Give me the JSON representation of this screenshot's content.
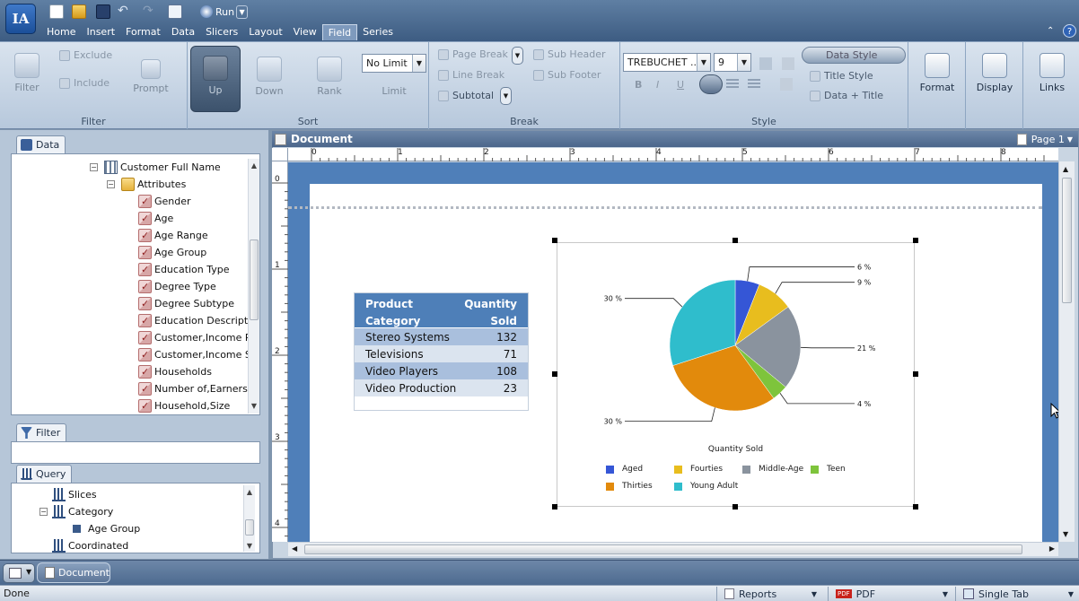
{
  "app": {
    "logo_text": "IA",
    "run_label": "Run",
    "menu": [
      {
        "label": "Home"
      },
      {
        "label": "Insert"
      },
      {
        "label": "Format"
      },
      {
        "label": "Data"
      },
      {
        "label": "Slicers"
      },
      {
        "label": "Layout"
      },
      {
        "label": "View"
      },
      {
        "label": "Field"
      },
      {
        "label": "Series"
      }
    ],
    "active_menu": "Field"
  },
  "ribbon": {
    "filter_group": {
      "label": "Filter",
      "filter": "Filter",
      "exclude": "Exclude",
      "include": "Include",
      "prompt": "Prompt"
    },
    "sort_group": {
      "label": "Sort",
      "up": "Up",
      "down": "Down",
      "rank": "Rank",
      "limit": "Limit",
      "limit_value": "No Limit"
    },
    "break_group": {
      "label": "Break",
      "page_break": "Page Break",
      "line_break": "Line Break",
      "subtotal": "Subtotal",
      "sub_header": "Sub Header",
      "sub_footer": "Sub Footer"
    },
    "style_group": {
      "label": "Style",
      "font_name": "TREBUCHET ...",
      "font_size": "9",
      "data_style": "Data Style",
      "title_style": "Title Style",
      "data_title": "Data + Title"
    },
    "format": "Format",
    "display": "Display",
    "links": "Links"
  },
  "data_panel": {
    "tab": "Data",
    "root": "Customer Full Name",
    "folder": "Attributes",
    "items": [
      "Gender",
      "Age",
      "Age Range",
      "Age Group",
      "Education Type",
      "Degree Type",
      "Degree Subtype",
      "Education Description",
      "Customer,Income Ra",
      "Customer,Income Su",
      "Households",
      "Number of,Earners",
      "Household,Size"
    ]
  },
  "filter_panel": {
    "tab": "Filter"
  },
  "query_panel": {
    "tab": "Query",
    "items": [
      {
        "label": "Slices"
      },
      {
        "label": "Category"
      },
      {
        "label": "Age Group"
      },
      {
        "label": "Coordinated"
      }
    ]
  },
  "document": {
    "title": "Document",
    "page_label": "Page 1",
    "ruler_h": [
      "0",
      "1",
      "2",
      "3",
      "4",
      "5",
      "6",
      "7",
      "8"
    ],
    "ruler_v": [
      "0",
      "1",
      "2",
      "3",
      "4"
    ]
  },
  "table": {
    "header_left_1": "Product",
    "header_left_2": "Category",
    "header_right_1": "Quantity",
    "header_right_2": "Sold",
    "rows": [
      {
        "category": "Stereo Systems",
        "qty": "132"
      },
      {
        "category": "Televisions",
        "qty": "71"
      },
      {
        "category": "Video Players",
        "qty": "108"
      },
      {
        "category": "Video Production",
        "qty": "23"
      }
    ]
  },
  "chart_data": {
    "type": "pie",
    "title": "Quantity Sold",
    "legend_position": "bottom",
    "labels": [
      "Aged",
      "Fourties",
      "Middle-Age",
      "Teen",
      "Thirties",
      "Young Adult"
    ],
    "values": [
      6,
      9,
      21,
      4,
      30,
      30
    ],
    "value_labels": [
      "6 %",
      "9 %",
      "21 %",
      "4 %",
      "30 %",
      "30 %"
    ],
    "colors": [
      "#3556d6",
      "#e8bd1e",
      "#8a939e",
      "#7ec43c",
      "#e28a0c",
      "#2fbdcc"
    ]
  },
  "bottom": {
    "doc_tab": "Document",
    "status": "Done",
    "reports": "Reports",
    "pdf_badge": "PDF",
    "pdf": "PDF",
    "single_tab": "Single Tab"
  }
}
